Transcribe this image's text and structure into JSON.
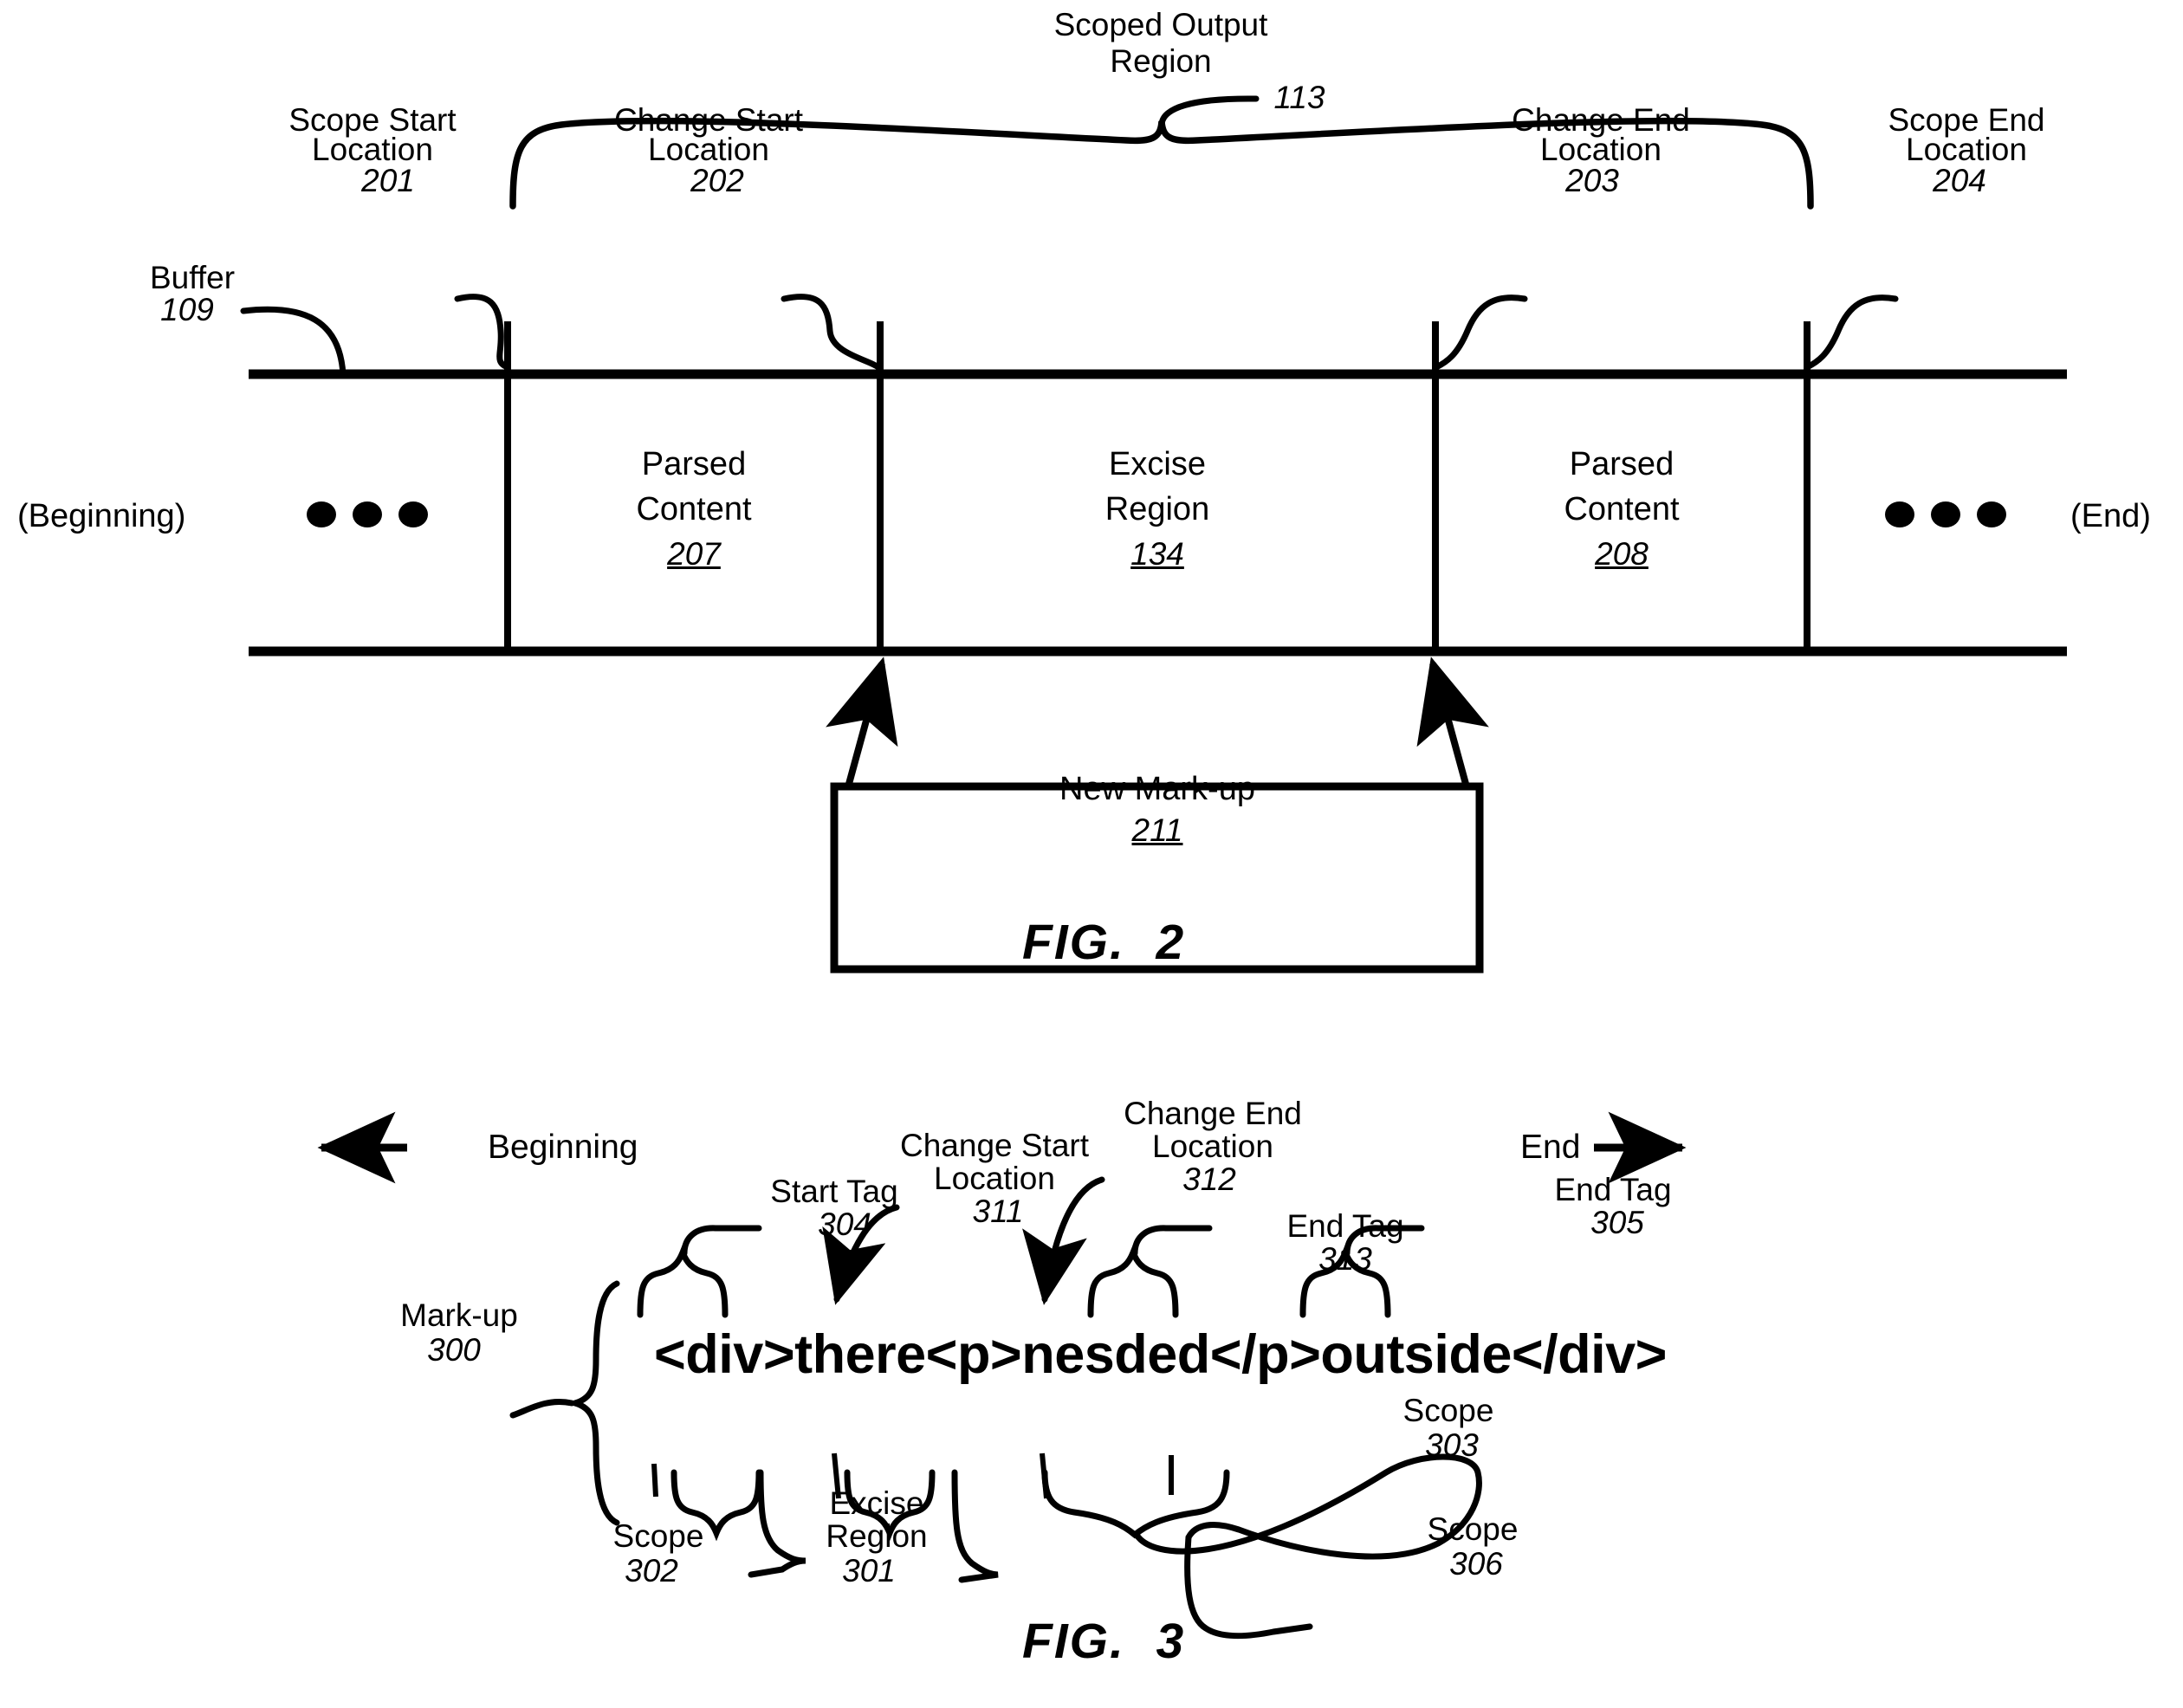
{
  "document": {
    "type": "patent-drawing-sheet",
    "figures": [
      "FIG.  2",
      "FIG.  3"
    ]
  },
  "fig2": {
    "caption": "FIG.  2",
    "callouts": {
      "scoped_output_region": {
        "line1": "Scoped Output",
        "line2": "Region",
        "ref": "113"
      },
      "scope_start_location": {
        "line1": "Scope Start",
        "line2": "Location",
        "ref": "201"
      },
      "change_start_location": {
        "line1": "Change Start",
        "line2": "Location",
        "ref": "202"
      },
      "change_end_location": {
        "line1": "Change End",
        "line2": "Location",
        "ref": "203"
      },
      "scope_end_location": {
        "line1": "Scope End",
        "line2": "Location",
        "ref": "204"
      },
      "buffer": {
        "line1": "Buffer",
        "ref": "109"
      }
    },
    "buffer_ends": {
      "beginning": "(Beginning)",
      "end": "(End)"
    },
    "segments": [
      {
        "line1": "Parsed",
        "line2": "Content",
        "ref": "207"
      },
      {
        "line1": "Excise",
        "line2": "Region",
        "ref": "134"
      },
      {
        "line1": "Parsed",
        "line2": "Content",
        "ref": "208"
      }
    ],
    "new_markup_box": {
      "line1": "New Mark-up",
      "ref": "211"
    }
  },
  "fig3": {
    "caption": "FIG.  3",
    "direction_labels": {
      "beginning": "Beginning",
      "end": "End"
    },
    "markup_string": "<div>there<p>nesded</p>outside</div>",
    "callouts": {
      "markup": {
        "line1": "Mark-up",
        "ref": "300"
      },
      "start_tag_304": {
        "line1": "Start Tag",
        "ref": "304"
      },
      "change_start_location": {
        "line1": "Change Start",
        "line2": "Location",
        "ref": "311"
      },
      "change_end_location": {
        "line1": "Change End",
        "line2": "Location",
        "ref": "312"
      },
      "end_tag_313": {
        "line1": "End Tag",
        "ref": "313"
      },
      "end_tag_305": {
        "line1": "End Tag",
        "ref": "305"
      },
      "scope_302": {
        "line1": "Scope",
        "ref": "302"
      },
      "excise_region_301": {
        "line1": "Excise",
        "line2": "Region",
        "ref": "301"
      },
      "scope_303": {
        "line1": "Scope",
        "ref": "303"
      },
      "scope_306": {
        "line1": "Scope",
        "ref": "306"
      }
    }
  },
  "style": {
    "ink": "#000000",
    "paper": "#ffffff"
  }
}
